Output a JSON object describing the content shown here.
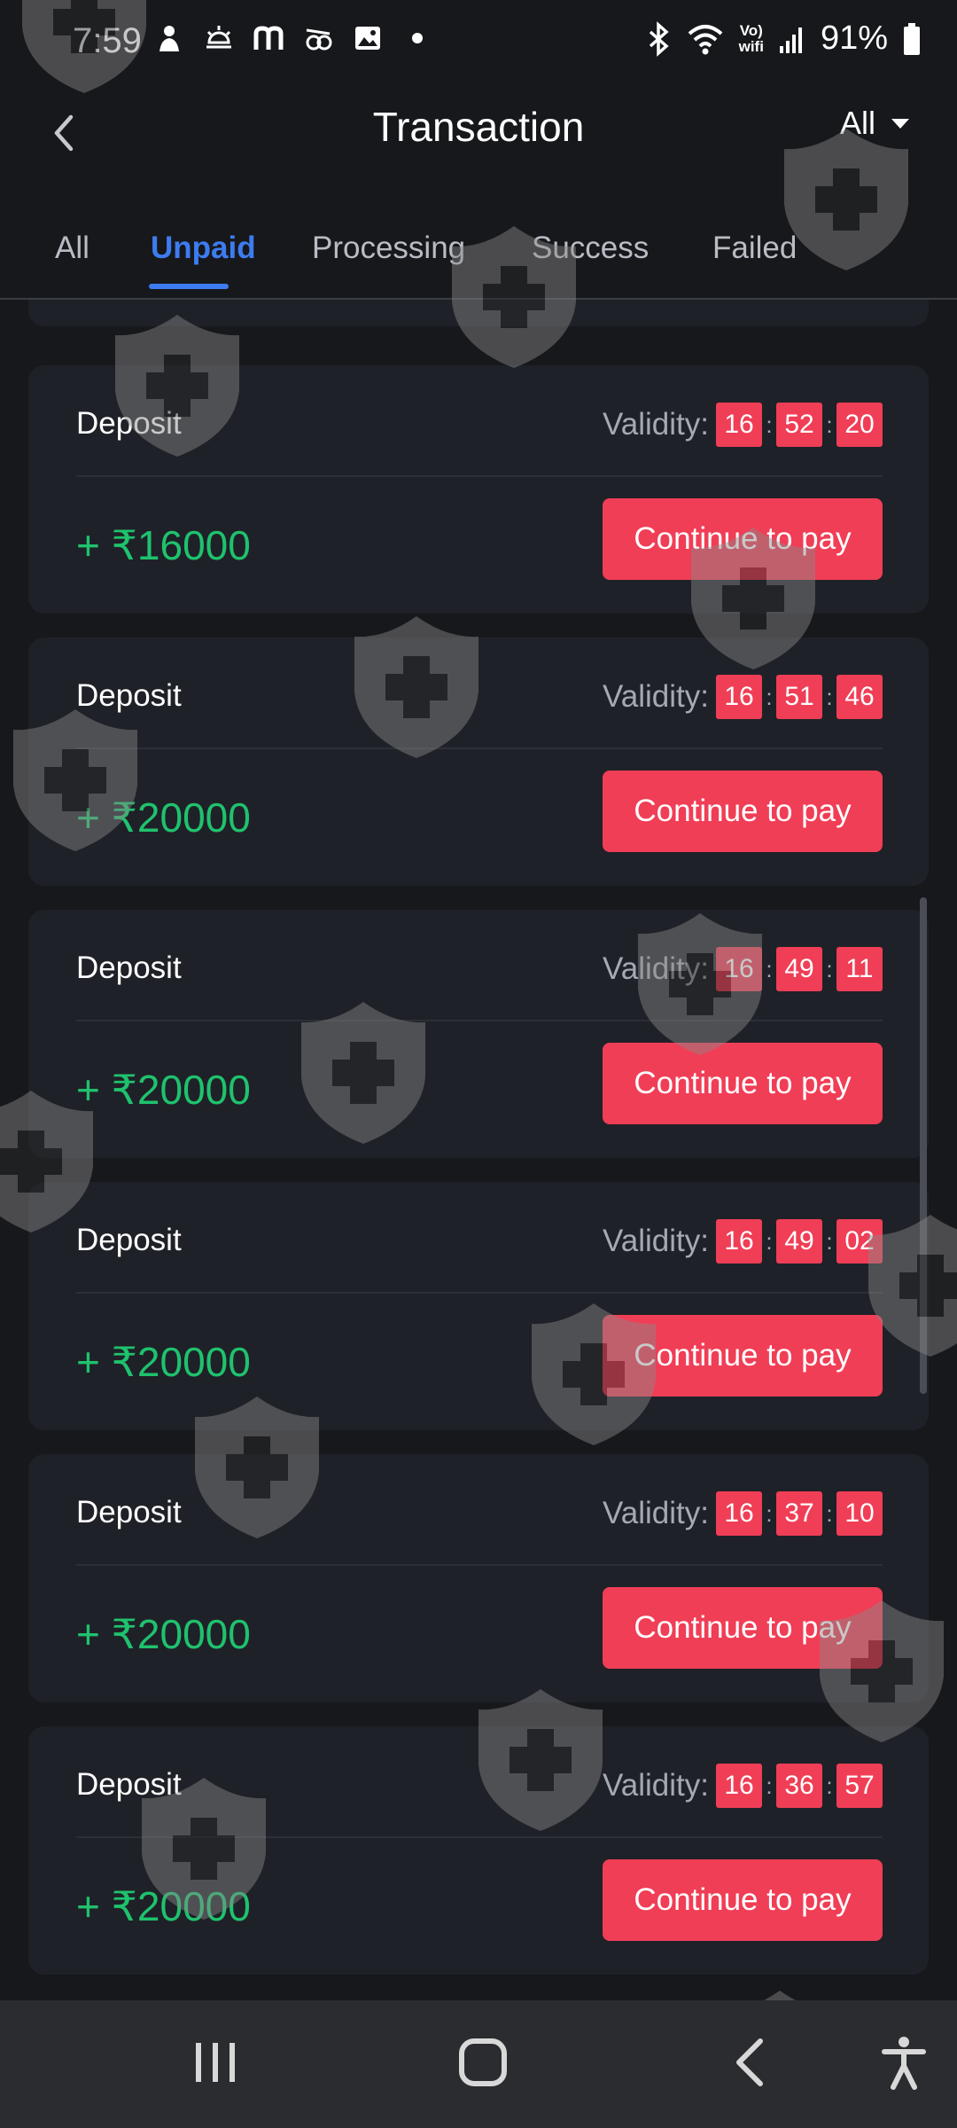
{
  "status_bar": {
    "time": "7:59",
    "battery": "91%",
    "left_icons": [
      "person-icon",
      "weather-icon",
      "m-app-icon",
      "bird-icon",
      "image-icon",
      "dot-icon"
    ],
    "right_icons": [
      "bluetooth-icon",
      "wifi-icon",
      "vowifi-icon",
      "signal-icon",
      "battery-icon"
    ],
    "vowifi_label_top": "Vo)",
    "vowifi_label_bottom": "wifi"
  },
  "header": {
    "title": "Transaction",
    "filter_label": "All"
  },
  "tabs": [
    {
      "label": "All",
      "active": false
    },
    {
      "label": "Unpaid",
      "active": true
    },
    {
      "label": "Processing",
      "active": false
    },
    {
      "label": "Success",
      "active": false
    },
    {
      "label": "Failed",
      "active": false
    }
  ],
  "validity_label": "Validity",
  "validity_separator": ":",
  "transactions": [
    {
      "type": "Deposit",
      "amount": "+ ₹16000",
      "validity": [
        "16",
        "52",
        "20"
      ],
      "button": "Continue to pay"
    },
    {
      "type": "Deposit",
      "amount": "+ ₹20000",
      "validity": [
        "16",
        "51",
        "46"
      ],
      "button": "Continue to pay"
    },
    {
      "type": "Deposit",
      "amount": "+ ₹20000",
      "validity": [
        "16",
        "49",
        "11"
      ],
      "button": "Continue to pay"
    },
    {
      "type": "Deposit",
      "amount": "+ ₹20000",
      "validity": [
        "16",
        "49",
        "02"
      ],
      "button": "Continue to pay"
    },
    {
      "type": "Deposit",
      "amount": "+ ₹20000",
      "validity": [
        "16",
        "37",
        "10"
      ],
      "button": "Continue to pay"
    },
    {
      "type": "Deposit",
      "amount": "+ ₹20000",
      "validity": [
        "16",
        "36",
        "57"
      ],
      "button": "Continue to pay"
    }
  ],
  "nav_bar": {
    "buttons": [
      "recent-apps-icon",
      "home-icon",
      "back-icon",
      "accessibility-icon"
    ]
  },
  "colors": {
    "background": "#17181c",
    "card": "#1f2128",
    "accent_blue": "#3d7cf0",
    "pay_red": "#f03e56",
    "amount_green": "#1fc26d"
  }
}
